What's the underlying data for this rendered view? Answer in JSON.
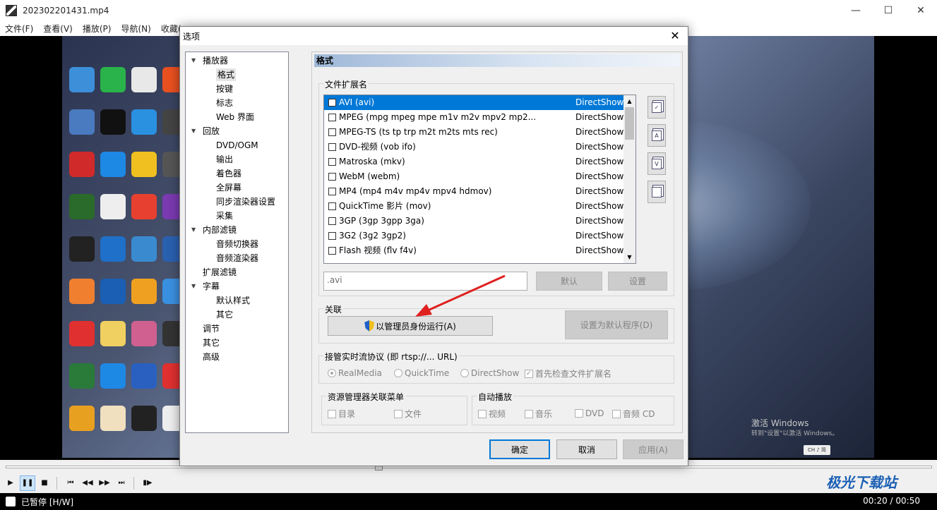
{
  "window": {
    "title": "202302201431.mp4",
    "minimize": "—",
    "maximize": "☐",
    "close": "✕"
  },
  "menu": [
    "文件(F)",
    "查看(V)",
    "播放(P)",
    "导航(N)",
    "收藏(..."
  ],
  "video": {
    "activate_text": "激活 Windows",
    "activate_sub": "转到\"设置\"以激活 Windows。",
    "lang_badge": "CH ♪ 简"
  },
  "status": {
    "state": "已暂停 [H/W]",
    "time": "00:20 / 00:50"
  },
  "watermark": "极光下载站",
  "dialog": {
    "title": "选项",
    "close": "✕",
    "tree": [
      {
        "label": "播放器",
        "level": 0,
        "expanded": true
      },
      {
        "label": "格式",
        "level": 1,
        "selected": true
      },
      {
        "label": "按键",
        "level": 1
      },
      {
        "label": "标志",
        "level": 1
      },
      {
        "label": "Web 界面",
        "level": 1
      },
      {
        "label": "回放",
        "level": 0,
        "expanded": true
      },
      {
        "label": "DVD/OGM",
        "level": 1
      },
      {
        "label": "输出",
        "level": 1
      },
      {
        "label": "着色器",
        "level": 1
      },
      {
        "label": "全屏幕",
        "level": 1
      },
      {
        "label": "同步渲染器设置",
        "level": 1
      },
      {
        "label": "采集",
        "level": 1
      },
      {
        "label": "内部滤镜",
        "level": 0,
        "expanded": true
      },
      {
        "label": "音频切换器",
        "level": 1
      },
      {
        "label": "音频渲染器",
        "level": 1
      },
      {
        "label": "扩展滤镜",
        "level": 0
      },
      {
        "label": "字幕",
        "level": 0,
        "expanded": true
      },
      {
        "label": "默认样式",
        "level": 1
      },
      {
        "label": "其它",
        "level": 1
      },
      {
        "label": "调节",
        "level": 0
      },
      {
        "label": "其它",
        "level": 0
      },
      {
        "label": "高级",
        "level": 0
      }
    ],
    "page_title": "格式",
    "ext_group_label": "文件扩展名",
    "extensions": [
      {
        "name": "AVI (avi)",
        "type": "DirectShow",
        "selected": true
      },
      {
        "name": "MPEG (mpg mpeg mpe m1v m2v mpv2 mp2...",
        "type": "DirectShow"
      },
      {
        "name": "MPEG-TS (ts tp trp m2t m2ts mts rec)",
        "type": "DirectShow"
      },
      {
        "name": "DVD-视频 (vob ifo)",
        "type": "DirectShow"
      },
      {
        "name": "Matroska (mkv)",
        "type": "DirectShow"
      },
      {
        "name": "WebM (webm)",
        "type": "DirectShow"
      },
      {
        "name": "MP4 (mp4 m4v mp4v mpv4 hdmov)",
        "type": "DirectShow"
      },
      {
        "name": "QuickTime 影片 (mov)",
        "type": "DirectShow"
      },
      {
        "name": "3GP (3gp 3gpp 3ga)",
        "type": "DirectShow"
      },
      {
        "name": "3G2 (3g2 3gp2)",
        "type": "DirectShow"
      },
      {
        "name": "Flash 视频 (flv f4v)",
        "type": "DirectShow"
      }
    ],
    "ext_input_value": ".avi",
    "default_button": "默认",
    "settings_button": "设置",
    "assoc_group_label": "关联",
    "run_as_admin_button": "以管理员身份运行(A)",
    "set_default_program_button": "设置为默认程序(D)",
    "rtsp_group_label": "接管实时流协议 (即 rtsp://... URL)",
    "rtsp_options": [
      "RealMedia",
      "QuickTime",
      "DirectShow"
    ],
    "rtsp_check_ext": "首先检查文件扩展名",
    "explorer_group_label": "资源管理器关联菜单",
    "explorer_options": [
      "目录",
      "文件"
    ],
    "autoplay_group_label": "自动播放",
    "autoplay_options": [
      "视频",
      "音乐",
      "DVD",
      "音频 CD"
    ],
    "ok_button": "确定",
    "cancel_button": "取消",
    "apply_button": "应用(A)"
  },
  "colors": {
    "selection": "#0078d7",
    "header_gradient": "#9fb8d8",
    "arrow": "#e02020"
  }
}
